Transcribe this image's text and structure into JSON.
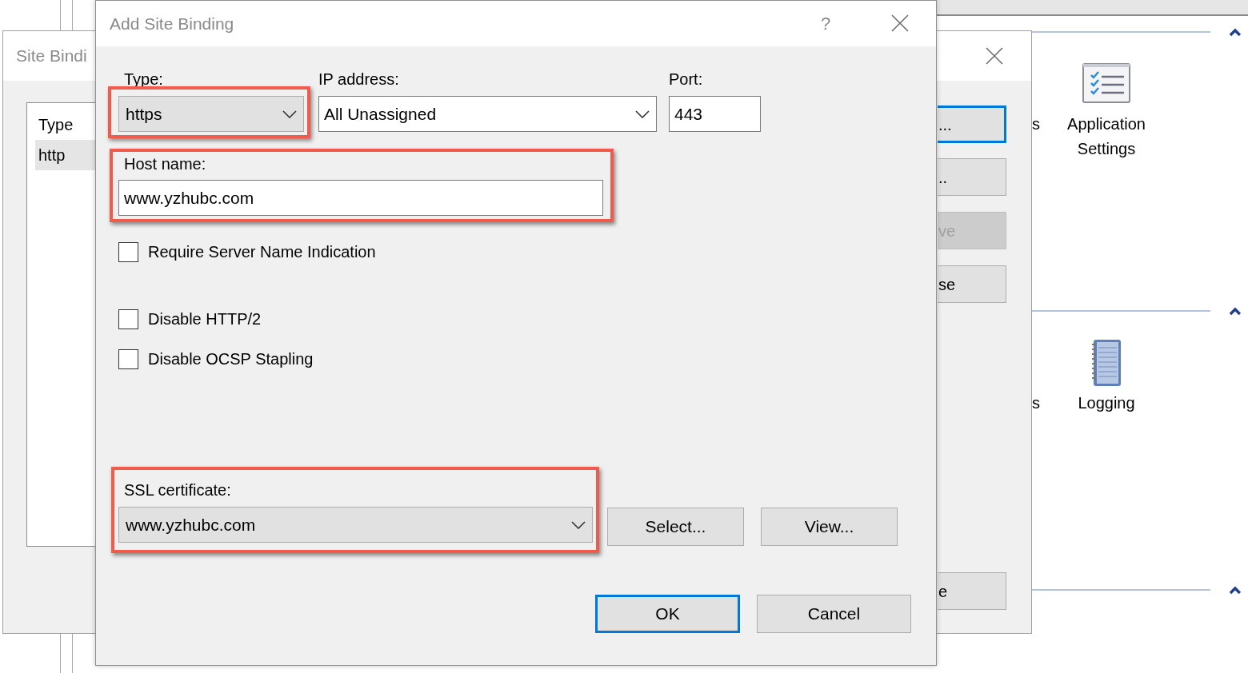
{
  "background_window": {
    "title": "Site Bindi",
    "list": {
      "columns": [
        "Type"
      ],
      "rows": [
        {
          "cells": [
            "http"
          ],
          "selected": true
        }
      ]
    },
    "buttons": [
      {
        "label": "...",
        "focused": true,
        "disabled": false
      },
      {
        "label": "..",
        "focused": false,
        "disabled": false
      },
      {
        "label": "ve",
        "focused": false,
        "disabled": true
      },
      {
        "label": "se",
        "focused": false,
        "disabled": false
      },
      {
        "label": "e",
        "focused": false,
        "disabled": false
      }
    ]
  },
  "features_panel": {
    "sections": [
      {
        "expanded": true,
        "items": [
          {
            "label": "s",
            "kind": "partial"
          },
          {
            "label": "Application Settings",
            "kind": "checklist"
          }
        ]
      },
      {
        "expanded": true,
        "items": [
          {
            "label": "s",
            "kind": "partial"
          },
          {
            "label": "Logging",
            "kind": "notebook"
          }
        ]
      },
      {
        "expanded": true
      }
    ]
  },
  "dialog": {
    "title": "Add Site Binding",
    "help": "?",
    "type": {
      "label": "Type:",
      "value": "https",
      "highlighted": true
    },
    "ip_address": {
      "label": "IP address:",
      "value": "All Unassigned"
    },
    "port": {
      "label": "Port:",
      "value": "443"
    },
    "host_name": {
      "label": "Host name:",
      "value": "www.yzhubc.com",
      "highlighted": true
    },
    "options": [
      {
        "label": "Require Server Name Indication",
        "checked": false
      },
      {
        "label": "Disable HTTP/2",
        "checked": false
      },
      {
        "label": "Disable OCSP Stapling",
        "checked": false
      }
    ],
    "ssl_certificate": {
      "label": "SSL certificate:",
      "value": "www.yzhubc.com",
      "highlighted": true
    },
    "certificate_buttons": [
      "Select...",
      "View..."
    ],
    "buttons": [
      {
        "label": "OK",
        "default": true
      },
      {
        "label": "Cancel",
        "default": false
      }
    ]
  }
}
